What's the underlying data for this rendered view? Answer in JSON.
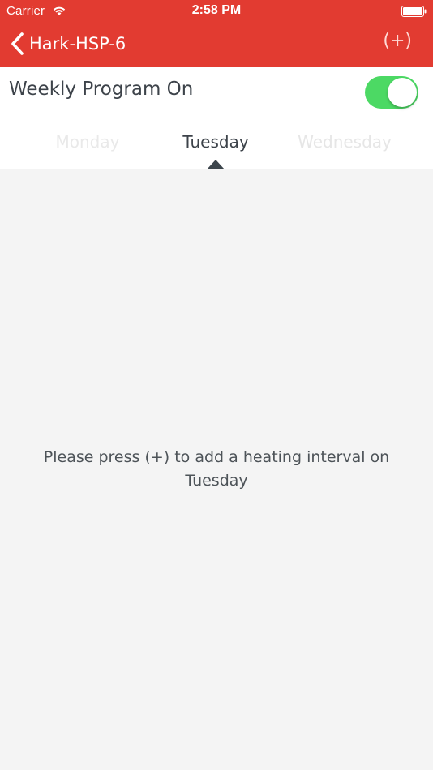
{
  "status_bar": {
    "carrier": "Carrier",
    "time": "2:58 PM",
    "wifi_icon": "wifi-icon",
    "battery_icon": "battery-icon"
  },
  "nav": {
    "back_label": "Hark-HSP-6",
    "back_icon": "chevron-left-icon",
    "add_label": "(+)"
  },
  "weekly_program": {
    "label": "Weekly Program On",
    "enabled": true
  },
  "day_tabs": {
    "previous": "Monday",
    "current": "Tuesday",
    "next": "Wednesday"
  },
  "empty_message": "Please press (+) to add a heating interval on Tuesday",
  "colors": {
    "header": "#e23b31",
    "toggle_on": "#4cd964",
    "text_dark": "#3d434a",
    "background": "#f4f4f4"
  }
}
